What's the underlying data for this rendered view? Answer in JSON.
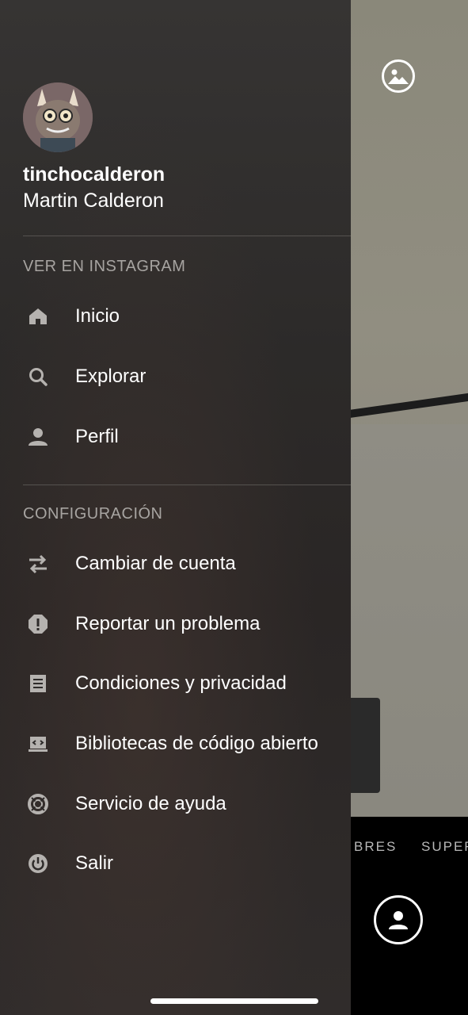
{
  "profile": {
    "username": "tinchocalderon",
    "full_name": "Martin Calderon"
  },
  "sections": {
    "view_title": "VER EN INSTAGRAM",
    "config_title": "CONFIGURACIÓN"
  },
  "view_items": [
    {
      "label": "Inicio",
      "icon": "home-icon"
    },
    {
      "label": "Explorar",
      "icon": "search-icon"
    },
    {
      "label": "Perfil",
      "icon": "person-icon"
    }
  ],
  "config_items": [
    {
      "label": "Cambiar de cuenta",
      "icon": "switch-arrows-icon"
    },
    {
      "label": "Reportar un problema",
      "icon": "alert-octagon-icon"
    },
    {
      "label": "Condiciones y privacidad",
      "icon": "document-icon"
    },
    {
      "label": "Bibliotecas de código abierto",
      "icon": "laptop-code-icon"
    },
    {
      "label": "Servicio de ayuda",
      "icon": "lifebuoy-icon"
    },
    {
      "label": "Salir",
      "icon": "power-icon"
    }
  ],
  "camera": {
    "filters": [
      "BRES",
      "SUPER"
    ]
  },
  "colors": {
    "drawer_bg": "#2e2b2a",
    "icon_gray": "#b5b2af",
    "section_gray": "#a7a4a1"
  }
}
